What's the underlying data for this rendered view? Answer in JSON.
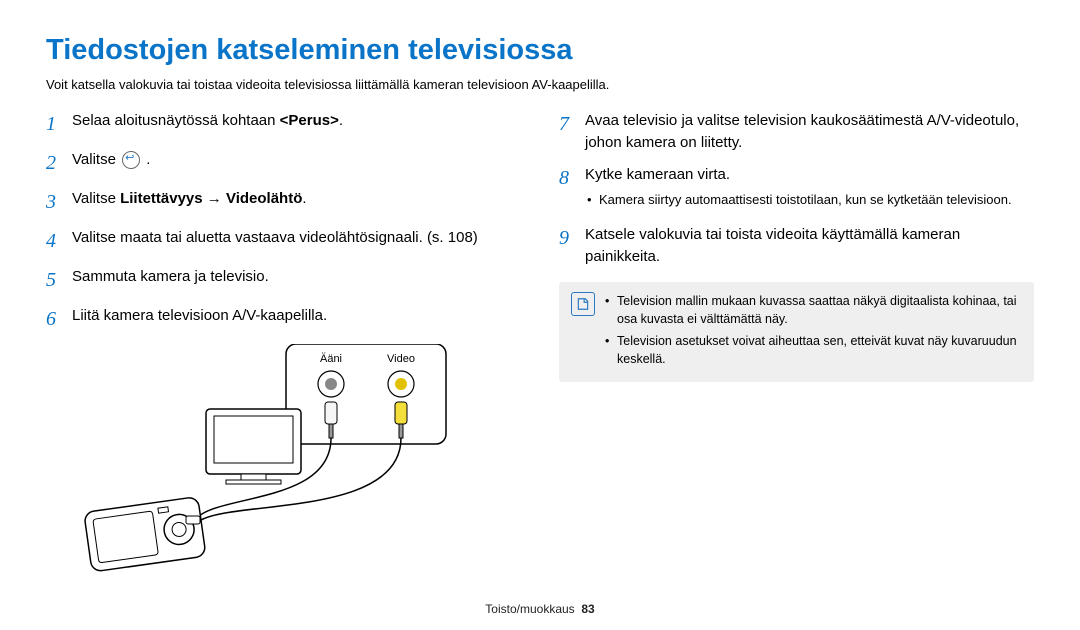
{
  "title": "Tiedostojen katseleminen televisiossa",
  "intro": "Voit katsella valokuvia tai toistaa videoita televisiossa liittämällä kameran televisioon AV-kaapelilla.",
  "left": [
    {
      "n": "1",
      "html": "Selaa aloitusnäytössä kohtaan <span class='angle'>&lt;Perus&gt;</span>."
    },
    {
      "n": "2",
      "html": "Valitse <span class='icon-circle'></span> ."
    },
    {
      "n": "3",
      "html": "Valitse <span class='bold'>Liitettävyys</span> → <span class='bold'>Videolähtö</span>."
    },
    {
      "n": "4",
      "html": "Valitse maata tai aluetta vastaava videolähtösignaali. (s. 108)"
    },
    {
      "n": "5",
      "html": "Sammuta kamera ja televisio."
    },
    {
      "n": "6",
      "html": "Liitä kamera televisioon A/V-kaapelilla."
    }
  ],
  "right": [
    {
      "n": "7",
      "html": "Avaa televisio ja valitse television kaukosäätimestä A/V-videotulo, johon kamera on liitetty."
    },
    {
      "n": "8",
      "html": "Kytke kameraan virta.",
      "sub": [
        "Kamera siirtyy automaattisesti toistotilaan, kun se kytketään televisioon."
      ]
    },
    {
      "n": "9",
      "html": "Katsele valokuvia tai toista videoita käyttämällä kameran painikkeita."
    }
  ],
  "notes": [
    "Television mallin mukaan kuvassa saattaa näkyä digitaalista kohinaa, tai osa kuvasta ei välttämättä näy.",
    "Television asetukset voivat aiheuttaa sen, etteivät kuvat näy kuvaruudun keskellä."
  ],
  "diagram": {
    "audio_label": "Ääni",
    "video_label": "Video"
  },
  "footer_section": "Toisto/muokkaus",
  "footer_page": "83"
}
